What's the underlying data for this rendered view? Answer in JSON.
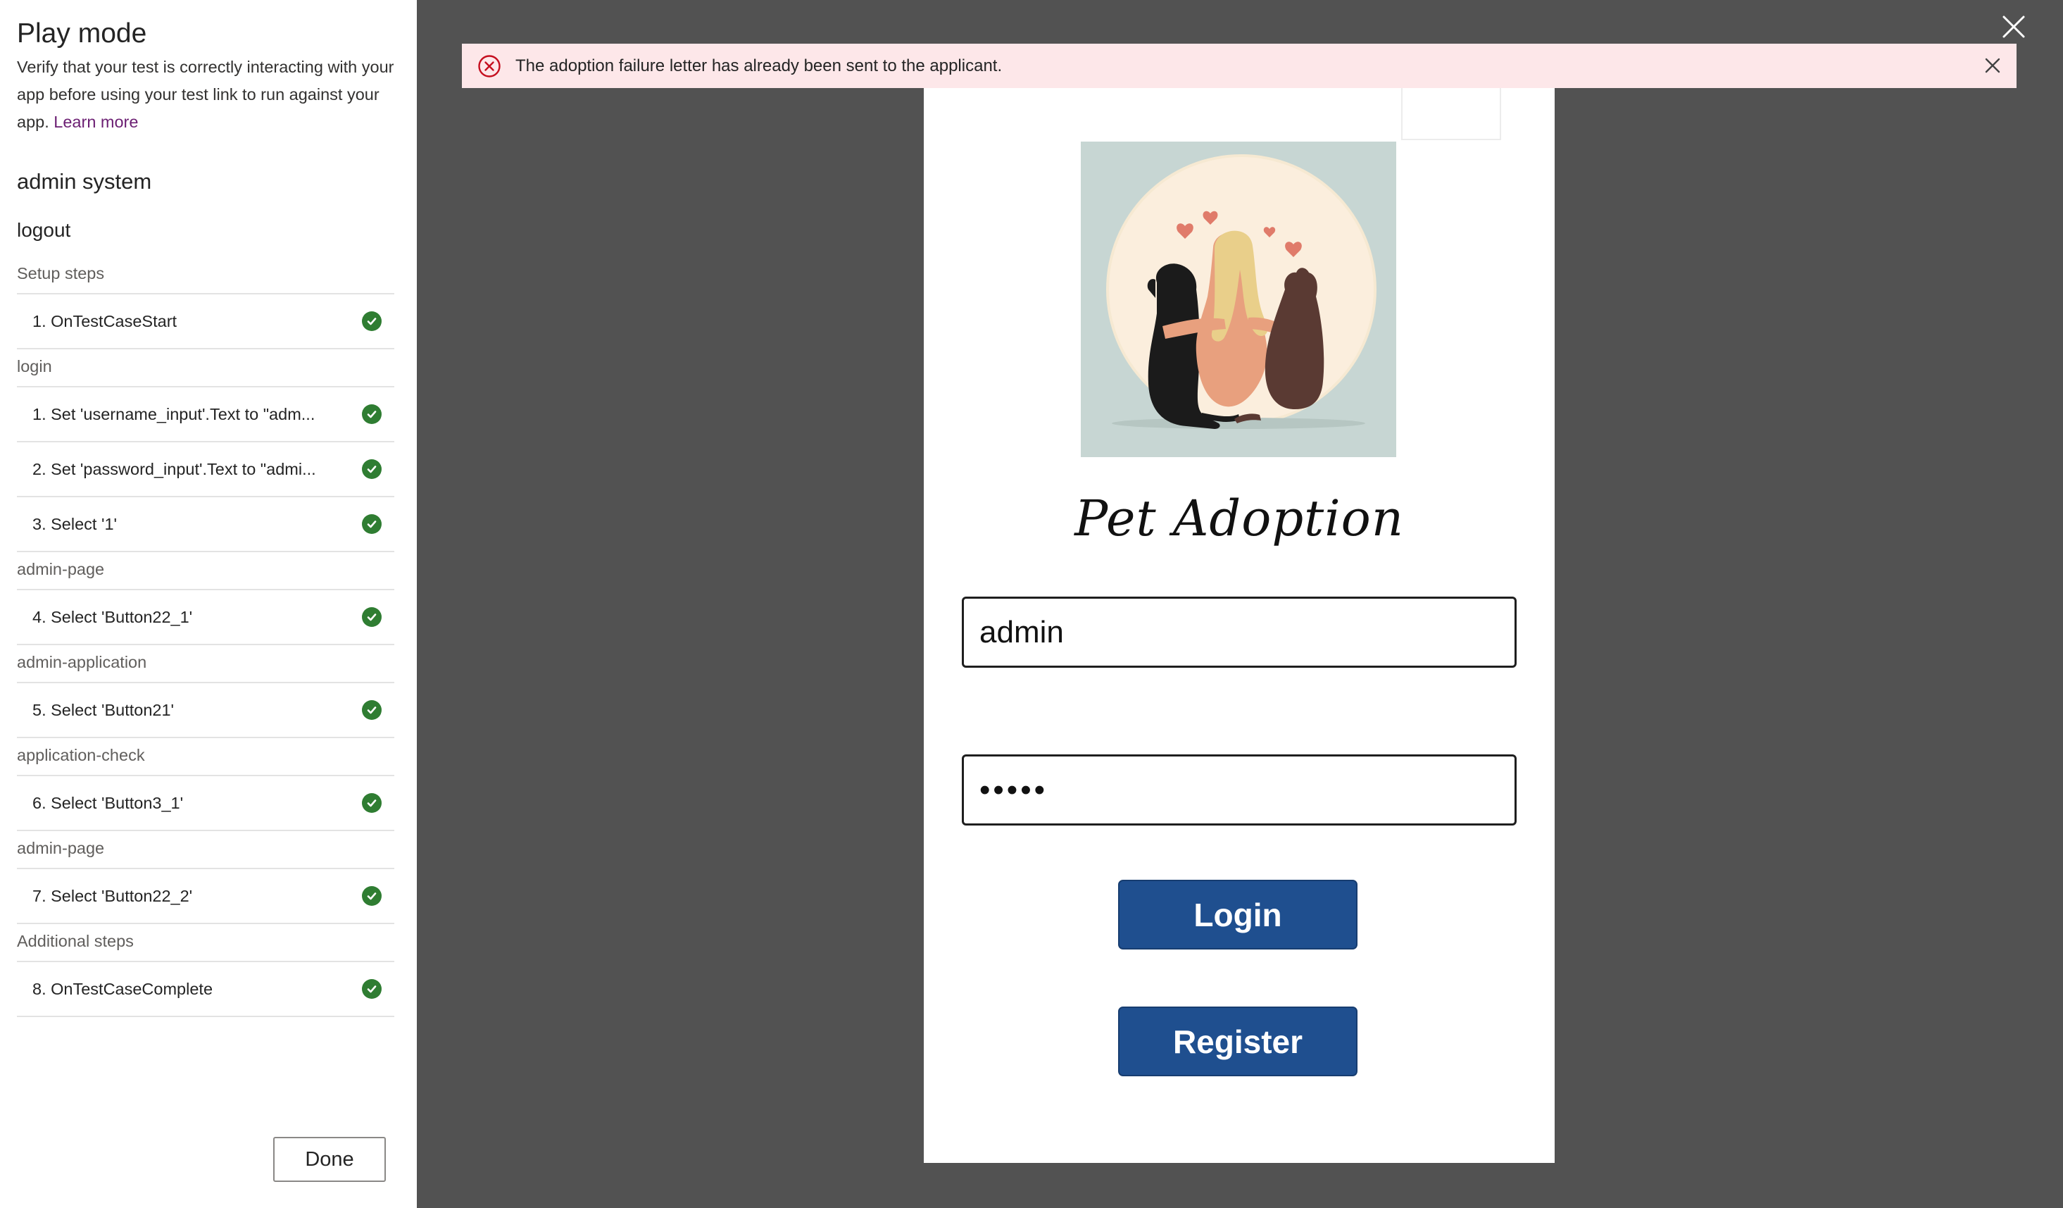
{
  "panel": {
    "title": "Play mode",
    "description": "Verify that your test is correctly interacting with your app before using your test link to run against your app.",
    "learn_more": "Learn more",
    "suite_title": "admin system",
    "case_title": "logout",
    "sections": [
      {
        "label": "Setup steps",
        "steps": [
          {
            "text": "1.  OnTestCaseStart",
            "status": "success"
          }
        ]
      },
      {
        "label": "login",
        "steps": [
          {
            "text": "1.  Set 'username_input'.Text to \"adm...",
            "status": "success"
          },
          {
            "text": "2.  Set 'password_input'.Text to \"admi...",
            "status": "success"
          },
          {
            "text": "3.  Select '1'",
            "status": "success"
          }
        ]
      },
      {
        "label": "admin-page",
        "steps": [
          {
            "text": "4.  Select 'Button22_1'",
            "status": "success"
          }
        ]
      },
      {
        "label": "admin-application",
        "steps": [
          {
            "text": "5.  Select 'Button21'",
            "status": "success"
          }
        ]
      },
      {
        "label": "application-check",
        "steps": [
          {
            "text": "6.  Select 'Button3_1'",
            "status": "success"
          }
        ]
      },
      {
        "label": "admin-page",
        "steps": [
          {
            "text": "7.  Select 'Button22_2'",
            "status": "success"
          }
        ]
      },
      {
        "label": "Additional steps",
        "steps": [
          {
            "text": "8.  OnTestCaseComplete",
            "status": "success"
          }
        ]
      }
    ],
    "done_label": "Done"
  },
  "banner": {
    "message": "The adoption failure letter has already been sent to the applicant.",
    "icon": "error-circle-icon"
  },
  "app": {
    "title": "Pet Adoption",
    "username_value": "admin",
    "password_value": "•••••",
    "login_label": "Login",
    "register_label": "Register"
  },
  "colors": {
    "success": "#2f7d32",
    "button": "#1f4f8f",
    "banner_bg": "#fde7e9",
    "error": "#c50f1f",
    "backdrop": "#525252",
    "link": "#6b1e72"
  }
}
